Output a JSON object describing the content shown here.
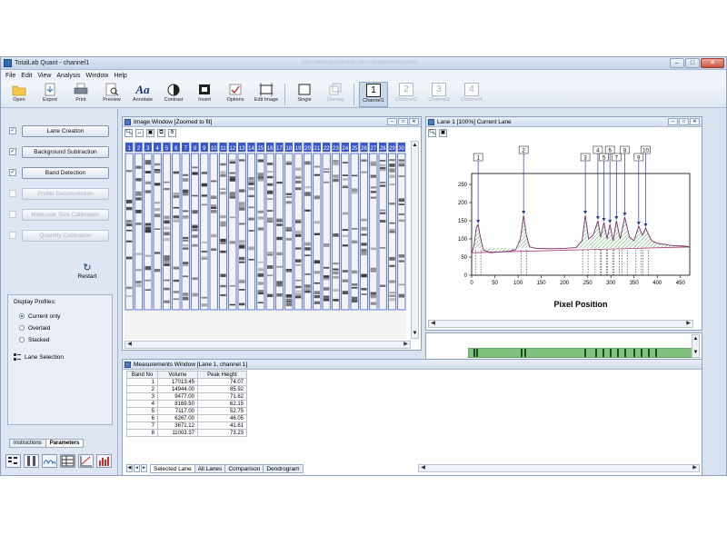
{
  "window": {
    "title": "TotalLab Quant - channel1",
    "title_ghost": "http://labtools.example.com / ImageWindow.html",
    "minimize": "–",
    "maximize": "□",
    "close": "✕"
  },
  "menu": [
    "File",
    "Edit",
    "View",
    "Analysis",
    "Window",
    "Help"
  ],
  "toolbar": {
    "open": "Open",
    "export": "Export",
    "print": "Print",
    "preview": "Preview",
    "annotate": "Annotate",
    "contrast": "Contrast",
    "invert": "Invert",
    "options": "Options",
    "edit_image": "Edit Image",
    "single": "Single",
    "overlay": "Overlay",
    "channel1": "Channel1",
    "channel2": "Channel2",
    "channel3": "Channel3",
    "channel4": "Channel4",
    "annotate_glyph": "Aa",
    "ch_nums": [
      "1",
      "2",
      "3",
      "4"
    ]
  },
  "left_panel": {
    "buttons": [
      {
        "label": "Lane Creation",
        "checked": "✓"
      },
      {
        "label": "Background Subtraction",
        "checked": "✓"
      },
      {
        "label": "Band Detection",
        "checked": "✓"
      },
      {
        "label": "Profile Deconvolution",
        "checked": ""
      },
      {
        "label": "Molecular Size Calibration",
        "checked": ""
      },
      {
        "label": "Quantity Calibration",
        "checked": ""
      }
    ],
    "restart": "Restart",
    "restart_glyph": "↻",
    "display_profiles_title": "Display Profiles:",
    "display_options": [
      "Current only",
      "Overlaid",
      "Stacked"
    ],
    "lane_selection": "Lane Selection",
    "tabs": [
      "Instructions",
      "Parameters"
    ]
  },
  "image_window": {
    "title": "Image Window [Zoomed to fit]",
    "lane_numbers": [
      "1",
      "2",
      "3",
      "4",
      "5",
      "6",
      "7",
      "8",
      "9",
      "10",
      "11",
      "12",
      "13",
      "14",
      "15",
      "16",
      "17",
      "18",
      "19",
      "20",
      "21",
      "22",
      "23",
      "24",
      "25",
      "26",
      "27",
      "28",
      "29",
      "30"
    ]
  },
  "lane_window": {
    "title": "Lane 1 [100%] Current Lane"
  },
  "measurements": {
    "title": "Measurements Window [Lane 1, channel 1]",
    "columns": [
      "Band No",
      "Volume",
      "Peak Height"
    ],
    "rows": [
      [
        "1",
        "17013.45",
        "74.07"
      ],
      [
        "2",
        "14944.00",
        "85.92"
      ],
      [
        "3",
        "9477.00",
        "71.62"
      ],
      [
        "4",
        "8169.50",
        "62.15"
      ],
      [
        "5",
        "7117.00",
        "52.75"
      ],
      [
        "6",
        "6267.00",
        "46.05"
      ],
      [
        "7",
        "3671.12",
        "41.61"
      ],
      [
        "8",
        "11003.37",
        "73.23"
      ]
    ],
    "tabs": [
      "Selected Lane",
      "All Lanes",
      "Comparison",
      "Dendrogram"
    ]
  },
  "chart_data": {
    "type": "line",
    "title": "",
    "xlabel": "Pixel Position",
    "ylabel": "",
    "xlim": [
      0,
      470
    ],
    "ylim": [
      0,
      280
    ],
    "xticks": [
      0,
      50,
      100,
      150,
      200,
      250,
      300,
      350,
      400,
      450
    ],
    "yticks": [
      0,
      50,
      100,
      150,
      200,
      250
    ],
    "grid": false,
    "series": [
      {
        "x": [
          0,
          5,
          10,
          14,
          18,
          25,
          40,
          60,
          80,
          95,
          105,
          112,
          118,
          125,
          140,
          170,
          200,
          225,
          238,
          245,
          252,
          262,
          272,
          278,
          285,
          292,
          298,
          305,
          312,
          320,
          330,
          340,
          350,
          360,
          368,
          375,
          380,
          388,
          400,
          430,
          460,
          470
        ],
        "y": [
          60,
          80,
          130,
          140,
          110,
          70,
          62,
          64,
          66,
          70,
          100,
          165,
          110,
          78,
          74,
          73,
          74,
          76,
          95,
          165,
          100,
          110,
          150,
          105,
          145,
          100,
          140,
          95,
          150,
          100,
          160,
          105,
          95,
          135,
          110,
          130,
          115,
          95,
          88,
          82,
          80,
          78
        ]
      }
    ],
    "bands": [
      {
        "label": "1",
        "x": 14,
        "y": 140
      },
      {
        "label": "2",
        "x": 112,
        "y": 165
      },
      {
        "label": "3",
        "x": 245,
        "y": 165
      },
      {
        "label": "4",
        "x": 272,
        "y": 150
      },
      {
        "label": "5",
        "x": 285,
        "y": 145
      },
      {
        "label": "6",
        "x": 298,
        "y": 140
      },
      {
        "label": "7",
        "x": 312,
        "y": 150
      },
      {
        "label": "8",
        "x": 330,
        "y": 160
      },
      {
        "label": "9",
        "x": 360,
        "y": 135
      },
      {
        "label": "10",
        "x": 375,
        "y": 130
      }
    ]
  }
}
